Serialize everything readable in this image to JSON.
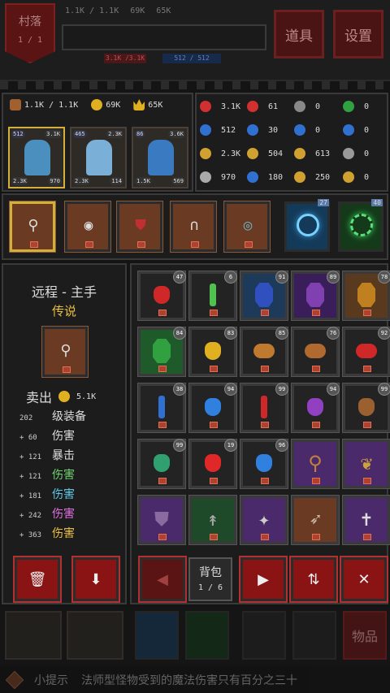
{
  "top": {
    "location": "村落",
    "location_page": "1 / 1",
    "food": "1.1K / 1.1K",
    "gold": "69K",
    "crown": "65K",
    "bar_left": "3.1K /3.1K",
    "bar_right": "512 / 512",
    "items_button": "道具",
    "settings_button": "设置"
  },
  "party": {
    "food": "1.1K / 1.1K",
    "gold": "69K",
    "crown": "65K",
    "heroes": [
      {
        "lv": "512",
        "hp": "3.1K",
        "bl": "2.3K",
        "br": "970"
      },
      {
        "lv": "465",
        "hp": "2.3K",
        "bl": "2.3K",
        "br": "114"
      },
      {
        "lv": "86",
        "hp": "3.6K",
        "bl": "1.5K",
        "br": "569"
      }
    ]
  },
  "stats": [
    {
      "icon": "max-hp-icon",
      "value": "3.1K",
      "color": "#d03030"
    },
    {
      "icon": "heart-icon",
      "value": "61",
      "color": "#d03030"
    },
    {
      "icon": "help-icon",
      "value": "0",
      "color": "#888888"
    },
    {
      "icon": "green-heart-icon",
      "value": "0",
      "color": "#30a040"
    },
    {
      "icon": "max-mp-icon",
      "value": "512",
      "color": "#3070d0"
    },
    {
      "icon": "mana-potion-icon",
      "value": "30",
      "color": "#3070d0"
    },
    {
      "icon": "blue-potion-icon",
      "value": "0",
      "color": "#3070d0"
    },
    {
      "icon": "blue-cross-icon",
      "value": "0",
      "color": "#3070d0"
    },
    {
      "icon": "attack-icon",
      "value": "2.3K",
      "color": "#d0a030"
    },
    {
      "icon": "gold-coin-icon",
      "value": "504",
      "color": "#d0a030"
    },
    {
      "icon": "gold-cross-icon",
      "value": "613",
      "color": "#d0a030"
    },
    {
      "icon": "shield-break-icon",
      "value": "0",
      "color": "#999999"
    },
    {
      "icon": "defense-icon",
      "value": "970",
      "color": "#aaaaaa"
    },
    {
      "icon": "blue-coin-icon",
      "value": "180",
      "color": "#3070d0"
    },
    {
      "icon": "gold-shield-icon",
      "value": "250",
      "color": "#d0a030"
    },
    {
      "icon": "gold-heart-icon",
      "value": "0",
      "color": "#d0a030"
    }
  ],
  "skills": {
    "skill1_badge": "27",
    "skill2_badge": "40"
  },
  "detail": {
    "title": "远程 - 主手",
    "rarity": "传说",
    "sell_label": "卖出",
    "sell_value": "5.1K",
    "lines": [
      {
        "prefix": "202",
        "label": "级装备",
        "color": "#dddddd"
      },
      {
        "prefix": "+ 60",
        "label": "伤害",
        "color": "#dddddd"
      },
      {
        "prefix": "+ 121",
        "label": "暴击",
        "color": "#dddddd"
      },
      {
        "prefix": "+ 121",
        "label": "伤害",
        "color": "#6fd36f"
      },
      {
        "prefix": "+ 181",
        "label": "伤害",
        "color": "#5fc8e8"
      },
      {
        "prefix": "+ 242",
        "label": "伤害",
        "color": "#e070e0"
      },
      {
        "prefix": "+ 363",
        "label": "伤害",
        "color": "#e8c040"
      }
    ]
  },
  "inventory": {
    "slots": [
      {
        "kind": "potion",
        "color": "#d02828",
        "bg": "#232323",
        "badge": "47"
      },
      {
        "kind": "vial",
        "color": "#50c050",
        "bg": "#232323",
        "badge": "6"
      },
      {
        "kind": "gem",
        "color": "#3050c0",
        "bg": "#1e3a5a",
        "badge": "91"
      },
      {
        "kind": "gem",
        "color": "#8040b0",
        "bg": "#3a1e5a",
        "badge": "89"
      },
      {
        "kind": "gem",
        "color": "#c08020",
        "bg": "#5a3a1e",
        "badge": "78"
      },
      {
        "kind": "gem",
        "color": "#30a040",
        "bg": "#1e5a2a",
        "badge": "84"
      },
      {
        "kind": "potion",
        "color": "#e0b020",
        "bg": "#232323",
        "badge": "83"
      },
      {
        "kind": "food",
        "color": "#c07a30",
        "bg": "#232323",
        "badge": "85"
      },
      {
        "kind": "food",
        "color": "#b06a30",
        "bg": "#232323",
        "badge": "76"
      },
      {
        "kind": "food",
        "color": "#d02828",
        "bg": "#232323",
        "badge": "92"
      },
      {
        "kind": "vial",
        "color": "#3070d0",
        "bg": "#232323",
        "badge": "38"
      },
      {
        "kind": "potion",
        "color": "#3080e0",
        "bg": "#232323",
        "badge": "94"
      },
      {
        "kind": "vial",
        "color": "#d02828",
        "bg": "#232323",
        "badge": "99"
      },
      {
        "kind": "potion",
        "color": "#9040c0",
        "bg": "#232323",
        "badge": "94"
      },
      {
        "kind": "potion",
        "color": "#9a6030",
        "bg": "#232323",
        "badge": "99"
      },
      {
        "kind": "potion",
        "color": "#30a070",
        "bg": "#232323",
        "badge": "99"
      },
      {
        "kind": "potion",
        "color": "#e02828",
        "bg": "#232323",
        "badge": "19"
      },
      {
        "kind": "potion",
        "color": "#3080e0",
        "bg": "#232323",
        "badge": "96"
      },
      {
        "kind": "staff",
        "color": "#c08040",
        "bg": "#4a2a6a",
        "badge": ""
      },
      {
        "kind": "amulet",
        "color": "#d0a040",
        "bg": "#4a2a6a",
        "badge": ""
      },
      {
        "kind": "armor",
        "color": "#8a6aa0",
        "bg": "#4a2a6a",
        "badge": ""
      },
      {
        "kind": "spear",
        "color": "#aaaaaa",
        "bg": "#1e4a2a",
        "badge": ""
      },
      {
        "kind": "bone",
        "color": "#cccccc",
        "bg": "#4a2a6a",
        "badge": ""
      },
      {
        "kind": "bow",
        "color": "#ccbbaa",
        "bg": "#6a3a22",
        "badge": ""
      },
      {
        "kind": "cross",
        "color": "#dddddd",
        "bg": "#4a2a6a",
        "badge": ""
      }
    ],
    "bag_label": "背包",
    "bag_page": "1 / 6"
  },
  "bottom": {
    "tip_label": "小提示",
    "tip_text": "法师型怪物受到的魔法伤害只有百分之三十",
    "items_label": "物品"
  }
}
